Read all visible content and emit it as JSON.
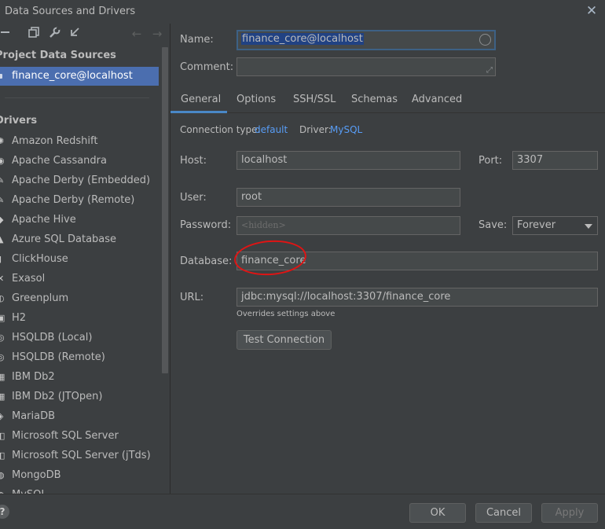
{
  "window": {
    "title": "Data Sources and Drivers",
    "close_icon": "✕"
  },
  "left": {
    "toolbar_icons": [
      "minus-icon",
      "copy-icon",
      "wrench-icon",
      "import-icon"
    ],
    "nav": {
      "back": "←",
      "forward": "→"
    },
    "project_section": "Project Data Sources",
    "project_item": "finance_core@localhost",
    "drivers_section": "Drivers",
    "drivers": [
      "Amazon Redshift",
      "Apache Cassandra",
      "Apache Derby (Embedded)",
      "Apache Derby (Remote)",
      "Apache Hive",
      "Azure SQL Database",
      "ClickHouse",
      "Exasol",
      "Greenplum",
      "H2",
      "HSQLDB (Local)",
      "HSQLDB (Remote)",
      "IBM Db2",
      "IBM Db2 (JTOpen)",
      "MariaDB",
      "Microsoft SQL Server",
      "Microsoft SQL Server (jTds)",
      "MongoDB",
      "MySQL"
    ]
  },
  "form": {
    "name_label": "Name:",
    "name_value": "finance_core@localhost",
    "comment_label": "Comment:",
    "comment_value": "",
    "tabs": [
      "General",
      "Options",
      "SSH/SSL",
      "Schemas",
      "Advanced"
    ],
    "active_tab": "General",
    "connection_type_label": "Connection type:",
    "connection_type_value": "default",
    "driver_label": "Driver:",
    "driver_value": "MySQL",
    "host_label": "Host:",
    "host_value": "localhost",
    "port_label": "Port:",
    "port_value": "3307",
    "user_label": "User:",
    "user_value": "root",
    "password_label": "Password:",
    "password_placeholder": "<hidden>",
    "save_label": "Save:",
    "save_value": "Forever",
    "database_label": "Database:",
    "database_value": "finance_core",
    "url_label": "URL:",
    "url_value": "jdbc:mysql://localhost:3307/finance_core",
    "url_hint": "Overrides settings above",
    "test_button": "Test Connection"
  },
  "footer": {
    "help": "?",
    "ok": "OK",
    "cancel": "Cancel",
    "apply": "Apply"
  },
  "colors": {
    "accent": "#4a88c7",
    "selection": "#4b6eaf",
    "link": "#589df6",
    "annotation": "#e01414",
    "background": "#3c3f41"
  }
}
